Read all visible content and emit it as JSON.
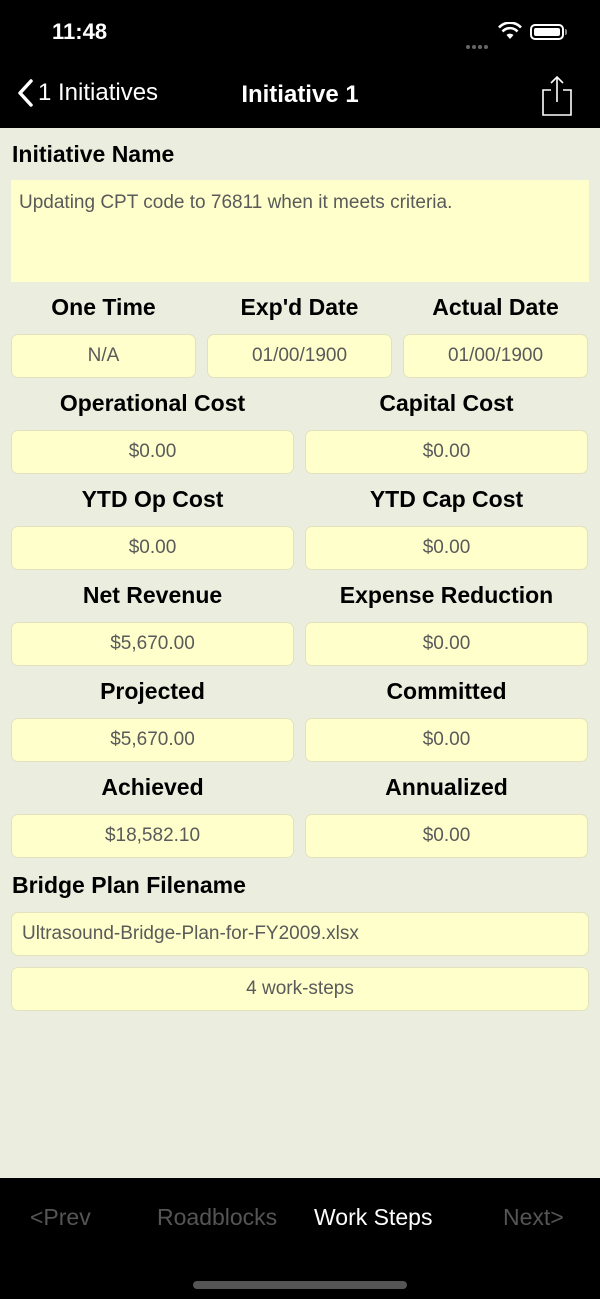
{
  "status_bar": {
    "time": "11:48"
  },
  "nav": {
    "back_label": "1 Initiatives",
    "title": "Initiative 1"
  },
  "initiative_name": {
    "label": "Initiative Name",
    "value": "Updating CPT code to 76811 when it meets criteria."
  },
  "dates": {
    "one_time": {
      "label": "One Time",
      "value": "N/A"
    },
    "expd_date": {
      "label": "Exp'd Date",
      "value": "01/00/1900"
    },
    "actual_date": {
      "label": "Actual Date",
      "value": "01/00/1900"
    }
  },
  "costs": {
    "operational_cost": {
      "label": "Operational Cost",
      "value": "$0.00"
    },
    "capital_cost": {
      "label": "Capital Cost",
      "value": "$0.00"
    },
    "ytd_op_cost": {
      "label": "YTD Op Cost",
      "value": "$0.00"
    },
    "ytd_cap_cost": {
      "label": "YTD Cap Cost",
      "value": "$0.00"
    },
    "net_revenue": {
      "label": "Net Revenue",
      "value": "$5,670.00"
    },
    "expense_reduction": {
      "label": "Expense Reduction",
      "value": "$0.00"
    },
    "projected": {
      "label": "Projected",
      "value": "$5,670.00"
    },
    "committed": {
      "label": "Committed",
      "value": "$0.00"
    },
    "achieved": {
      "label": "Achieved",
      "value": "$18,582.10"
    },
    "annualized": {
      "label": "Annualized",
      "value": "$0.00"
    }
  },
  "bridge_plan": {
    "label": "Bridge Plan Filename",
    "value": "Ultrasound-Bridge-Plan-for-FY2009.xlsx"
  },
  "work_steps": {
    "value": "4 work-steps"
  },
  "tabbar": {
    "prev": "<Prev",
    "roadblocks": "Roadblocks",
    "work_steps": "Work Steps",
    "next": "Next>"
  }
}
